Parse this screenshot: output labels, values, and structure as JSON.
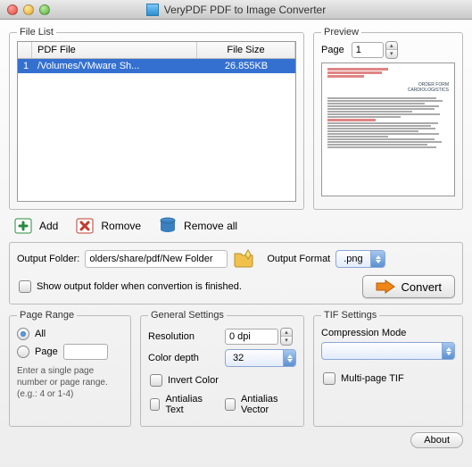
{
  "window": {
    "title": "VeryPDF PDF to Image Converter"
  },
  "fileList": {
    "legend": "File List",
    "headers": {
      "file": "PDF File",
      "size": "File Size"
    },
    "rows": [
      {
        "idx": "1",
        "file": "/Volumes/VMware Sh...",
        "size": "26.855KB"
      }
    ]
  },
  "preview": {
    "legend": "Preview",
    "pageLabel": "Page",
    "pageValue": "1"
  },
  "toolbar": {
    "add": "Add",
    "remove": "Romove",
    "removeAll": "Remove all"
  },
  "output": {
    "folderLabel": "Output Folder:",
    "folderValue": "olders/share/pdf/New Folder",
    "formatLabel": "Output Format",
    "formatValue": ".png",
    "showFolderCheck": "Show output folder when convertion is finished.",
    "convert": "Convert"
  },
  "pageRange": {
    "legend": "Page Range",
    "all": "All",
    "page": "Page",
    "hint": "Enter a single page number or page range.(e.g.: 4 or 1-4)"
  },
  "general": {
    "legend": "General Settings",
    "resolutionLabel": "Resolution",
    "resolutionValue": "0 dpi",
    "colorDepthLabel": "Color depth",
    "colorDepthValue": "32",
    "invert": "Invert Color",
    "antialiasText": "Antialias Text",
    "antialiasVector": "Antialias Vector"
  },
  "tif": {
    "legend": "TIF Settings",
    "compressionLabel": "Compression Mode",
    "compressionValue": "",
    "multiPage": "Multi-page TIF"
  },
  "about": "About"
}
